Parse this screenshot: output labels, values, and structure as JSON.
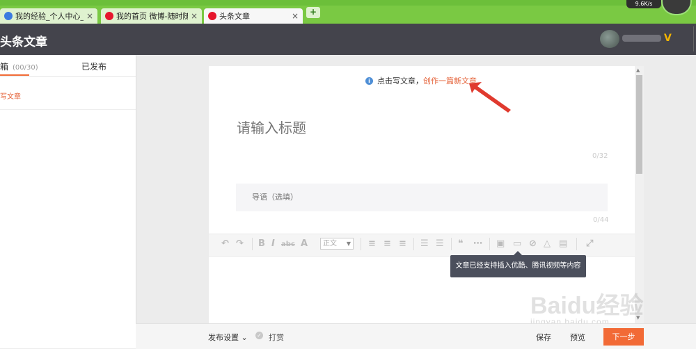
{
  "browser": {
    "tabs": [
      {
        "label": "我的经验_个人中心_百度",
        "close": "×"
      },
      {
        "label": "我的首页 微博-随时随地",
        "close": "×"
      },
      {
        "label": "头条文章",
        "close": "×"
      }
    ],
    "new_tab": "+",
    "net_speed": "9.6K/s"
  },
  "header": {
    "title": "头条文章",
    "badge": "V"
  },
  "sidebar": {
    "drafts_tab": "箱",
    "drafts_count": "(00/30)",
    "published_tab": "已发布",
    "draft_item": "写文章"
  },
  "editor": {
    "hint_text": "点击写文章，",
    "hint_link": "创作一篇新文章",
    "title_placeholder": "请输入标题",
    "title_count": "0/32",
    "lead_placeholder": "导语（选填）",
    "lead_count": "0/44",
    "format_select": "正文",
    "tooltip": "文章已经支持插入优酷、腾讯视频等内容"
  },
  "footer": {
    "publish_settings": "发布设置",
    "reward": "打赏",
    "save": "保存",
    "preview": "预览",
    "next": "下一步"
  },
  "watermark": {
    "logo": "Baidu经验",
    "url": "jingyan.baidu.com"
  },
  "colors": {
    "accent": "#f26a36",
    "link": "#e5633a",
    "header_bg": "#44444c",
    "browser_green": "#7ac943"
  }
}
